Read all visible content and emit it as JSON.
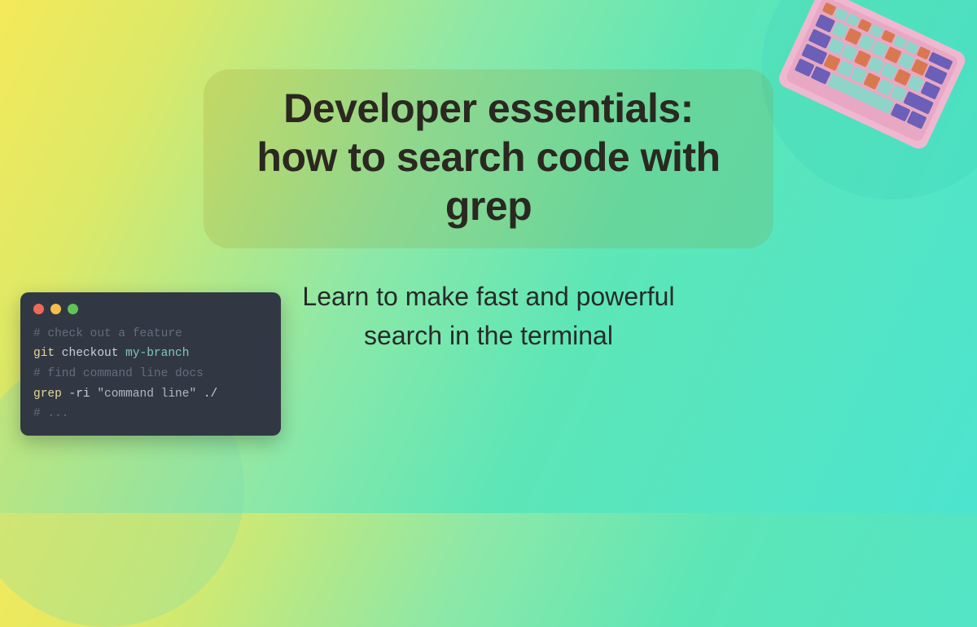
{
  "title": "Developer essentials: how to search code with grep",
  "subtitle": "Learn to make fast and powerful search in the terminal",
  "terminal": {
    "lines": [
      {
        "type": "comment",
        "text": "# check out a feature"
      },
      {
        "type": "cmd",
        "parts": [
          {
            "c": "cmd",
            "t": "git"
          },
          {
            "c": "text",
            "t": " checkout "
          },
          {
            "c": "arg",
            "t": "my-branch"
          }
        ]
      },
      {
        "type": "comment",
        "text": "# find command line docs"
      },
      {
        "type": "cmd",
        "parts": [
          {
            "c": "cmd",
            "t": "grep"
          },
          {
            "c": "text",
            "t": " -ri "
          },
          {
            "c": "str",
            "t": "\"command line\""
          },
          {
            "c": "text",
            "t": " ./"
          }
        ]
      },
      {
        "type": "comment",
        "text": "# ..."
      }
    ]
  }
}
